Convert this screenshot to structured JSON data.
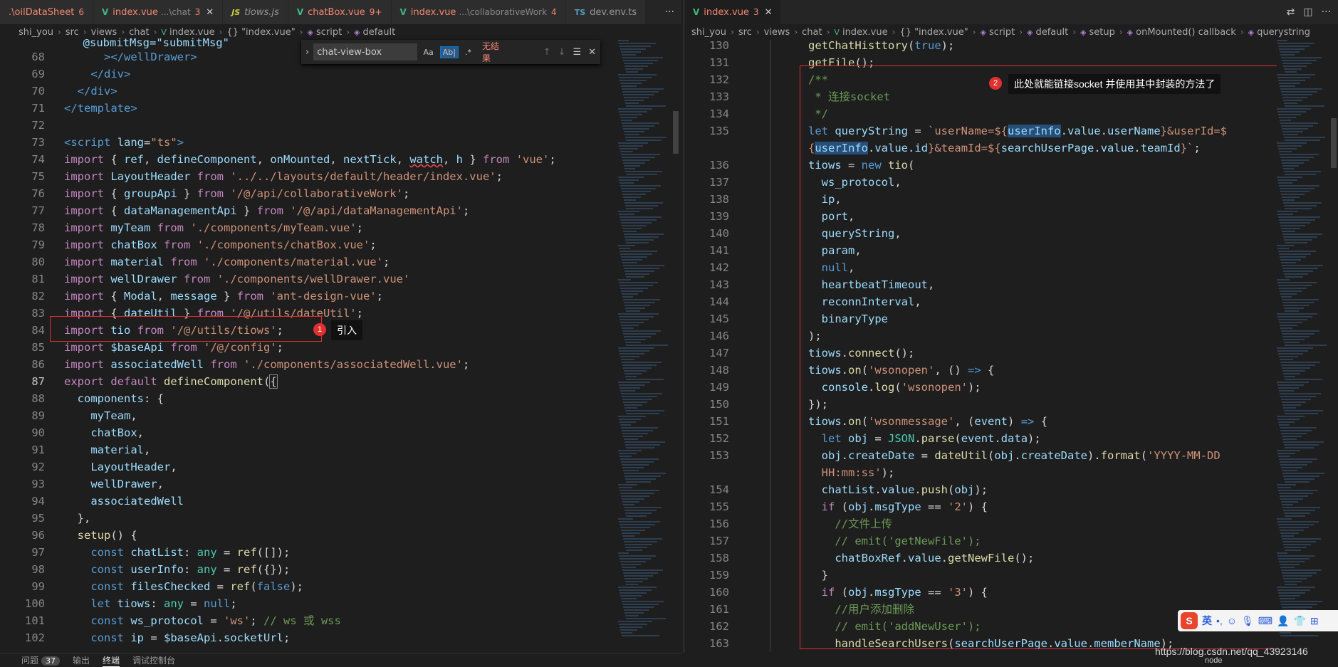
{
  "left": {
    "tabs": [
      {
        "icon": "",
        "name": ".\\oilDataSheet",
        "desc": "",
        "count": "6",
        "active": false,
        "err": true,
        "iconname": "none"
      },
      {
        "icon": "V",
        "name": "index.vue",
        "desc": "...\\chat",
        "count": "3",
        "active": false,
        "err": true,
        "iconname": "vue-icon",
        "close": "✕"
      },
      {
        "icon": "JS",
        "name": "tiows.js",
        "desc": "",
        "count": "",
        "active": false,
        "err": false,
        "iconname": "js-icon"
      },
      {
        "icon": "V",
        "name": "chatBox.vue",
        "desc": "",
        "count": "9+",
        "active": false,
        "err": true,
        "iconname": "vue-icon"
      },
      {
        "icon": "V",
        "name": "index.vue",
        "desc": "...\\collaborativeWork",
        "count": "4",
        "active": false,
        "err": true,
        "iconname": "vue-icon"
      },
      {
        "icon": "TS",
        "name": "dev.env.ts",
        "desc": "",
        "count": "",
        "active": false,
        "err": false,
        "iconname": "ts-icon"
      }
    ],
    "more": "···",
    "breadcrumb": [
      "shi_you",
      "src",
      "views",
      "chat",
      "index.vue",
      "{} \"index.vue\"",
      "script",
      "default"
    ],
    "find": {
      "query": "chat-view-box",
      "opt_case": "Aa",
      "opt_word": "Ab|",
      "opt_regex": ".*",
      "result": "无结果",
      "prev": "↑",
      "next": "↓",
      "sel": "☰",
      "close": "✕",
      "toggle": "›"
    },
    "callout": {
      "badge": "1",
      "text": "引入"
    }
  },
  "right": {
    "tabs": [
      {
        "icon": "V",
        "name": "index.vue",
        "desc": "",
        "count": "3",
        "active": true,
        "err": true,
        "iconname": "vue-icon",
        "close": "✕"
      }
    ],
    "breadcrumb": [
      "shi_you",
      "src",
      "views",
      "chat",
      "index.vue",
      "{} \"index.vue\"",
      "script",
      "default",
      "setup",
      "onMounted() callback",
      "querystring"
    ],
    "callout": {
      "badge": "2",
      "text": "此处就能链接socket 并使用其中封装的方法了"
    }
  },
  "panel": {
    "tabs": [
      "问题",
      "输出",
      "终端",
      "调试控制台"
    ],
    "problems_count": "37"
  },
  "ime": {
    "logo": "S",
    "lang": "英",
    "items": [
      "•,",
      "☺",
      "🎙",
      "⌨",
      "👤",
      "👕",
      "⊞"
    ]
  },
  "watermark": "https://blog.csdn.net/qq_43923146",
  "status_right": "node",
  "colors": {
    "accent": "#007acc",
    "error": "#f48771",
    "annotation": "#e03030"
  }
}
